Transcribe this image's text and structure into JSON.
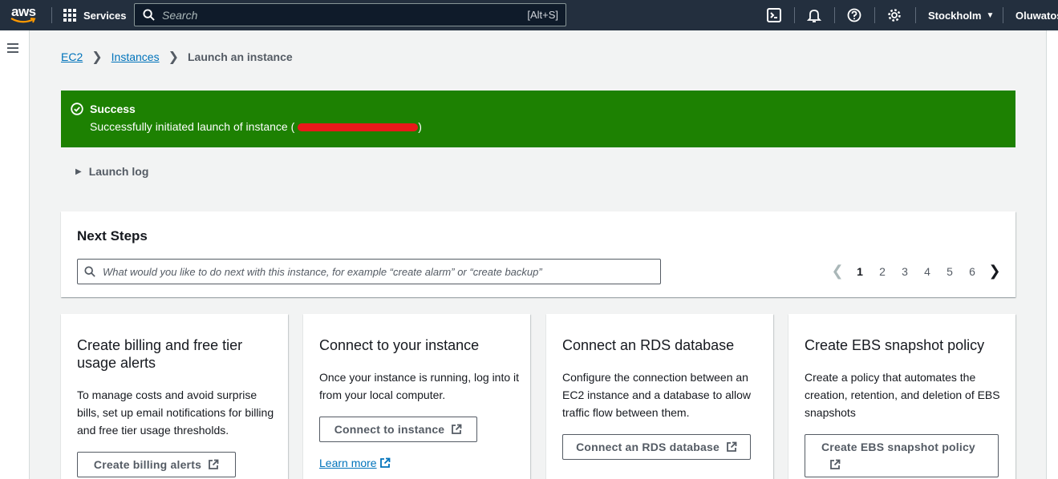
{
  "topnav": {
    "logo_text": "aws",
    "services_label": "Services",
    "search_placeholder": "Search",
    "search_shortcut": "[Alt+S]",
    "region": "Stockholm",
    "account": "Oluwatos"
  },
  "breadcrumb": {
    "items": [
      "EC2",
      "Instances"
    ],
    "current": "Launch an instance"
  },
  "flash": {
    "title": "Success",
    "message": "Successfully initiated launch of instance (",
    "closing": ")"
  },
  "launch_log": "Launch log",
  "next_steps": {
    "title": "Next Steps",
    "search_placeholder": "What would you like to do next with this instance, for example “create alarm” or “create backup”",
    "pages": [
      "1",
      "2",
      "3",
      "4",
      "5",
      "6"
    ],
    "current_page": "1"
  },
  "cards": [
    {
      "title": "Create billing and free tier usage alerts",
      "description": "To manage costs and avoid surprise bills, set up email notifications for billing and free tier usage thresholds.",
      "button": "Create billing alerts"
    },
    {
      "title": "Connect to your instance",
      "description": "Once your instance is running, log into it from your local computer.",
      "button": "Connect to instance",
      "link": "Learn more"
    },
    {
      "title": "Connect an RDS database",
      "description": "Configure the connection between an EC2 instance and a database to allow traffic flow between them.",
      "button": "Connect an RDS database"
    },
    {
      "title": "Create EBS snapshot policy",
      "description": "Create a policy that automates the creation, retention, and deletion of EBS snapshots",
      "button": "Create EBS snapshot policy"
    }
  ],
  "colors": {
    "topnav_bg": "#232f3e",
    "success_green": "#1d8102",
    "link_blue": "#0073bb",
    "aws_orange": "#ff9900"
  }
}
